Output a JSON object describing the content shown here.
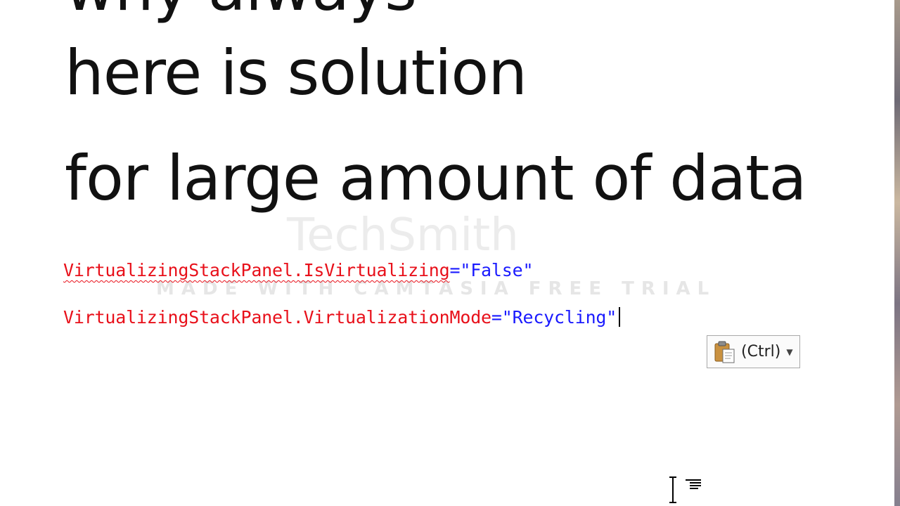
{
  "slide": {
    "line_top": "why always",
    "line_1": "here is solution",
    "line_2": "for large amount of data"
  },
  "code": {
    "line_1": {
      "attr": "VirtualizingStackPanel.IsVirtualizing",
      "eq": "=",
      "value": "\"False\""
    },
    "line_2": {
      "attr": "VirtualizingStackPanel.VirtualizationMode",
      "eq": "=",
      "value": "\"Recycling\""
    }
  },
  "paste_options": {
    "label": "(Ctrl)",
    "icon": "clipboard-paste-icon",
    "dropdown_icon": "triangle-down-icon"
  },
  "watermark": {
    "logo": "TechSmith",
    "text": "MADE WITH CAMTASIA FREE TRIAL"
  },
  "colors": {
    "attribute": "#e8101a",
    "value": "#1a1aff",
    "text": "#111111"
  }
}
